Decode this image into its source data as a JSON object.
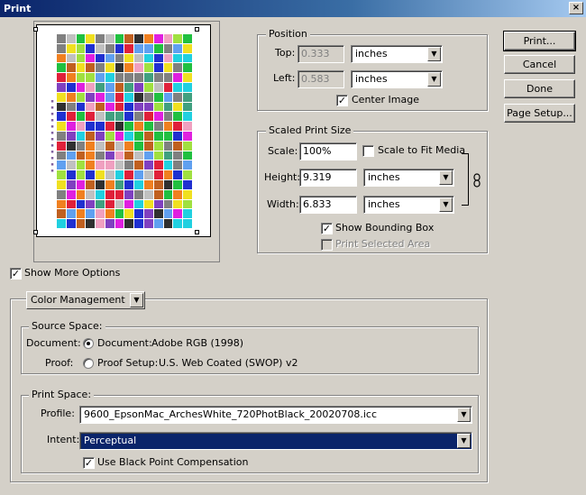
{
  "window": {
    "title": "Print",
    "close_symbol": "×"
  },
  "buttons": {
    "print": "Print...",
    "cancel": "Cancel",
    "done": "Done",
    "page_setup": "Page Setup..."
  },
  "position": {
    "group_label": "Position",
    "top_label": "Top:",
    "top_value": "0.333",
    "top_unit": "inches",
    "left_label": "Left:",
    "left_value": "0.583",
    "left_unit": "inches",
    "center_image_label": "Center Image",
    "center_image_checked": true
  },
  "scaled": {
    "group_label": "Scaled Print Size",
    "scale_label": "Scale:",
    "scale_value": "100%",
    "scale_to_fit_label": "Scale to Fit Media",
    "scale_to_fit_checked": false,
    "height_label": "Height:",
    "height_value": "9.319",
    "height_unit": "inches",
    "width_label": "Width:",
    "width_value": "6.833",
    "width_unit": "inches",
    "show_bbox_label": "Show Bounding Box",
    "show_bbox_checked": true,
    "print_selected_label": "Print Selected Area",
    "print_selected_checked": false
  },
  "show_more_options": {
    "label": "Show More Options",
    "checked": true
  },
  "color_mgmt": {
    "dropdown_value": "Color Management",
    "source_space": {
      "group_label": "Source Space:",
      "document_row_label": "Document:",
      "document_option_label": "Document:",
      "document_profile": "Adobe RGB (1998)",
      "proof_row_label": "Proof:",
      "proof_option_label": "Proof Setup:",
      "proof_profile": "U.S. Web Coated (SWOP) v2",
      "selected": "document"
    },
    "print_space": {
      "group_label": "Print Space:",
      "profile_label": "Profile:",
      "profile_value": "9600_EpsonMac_ArchesWhite_720PhotBlack_20020708.icc",
      "intent_label": "Intent:",
      "intent_value": "Perceptual",
      "bpc_label": "Use Black Point Compensation",
      "bpc_checked": true
    }
  },
  "icons": {
    "dropdown_arrow": "▼",
    "checkmark": "✓",
    "link": "chain-link-icon"
  },
  "colors": {
    "title_bar": "#0a246a",
    "dialog_bg": "#d4d0c8",
    "selection": "#0a246a"
  }
}
